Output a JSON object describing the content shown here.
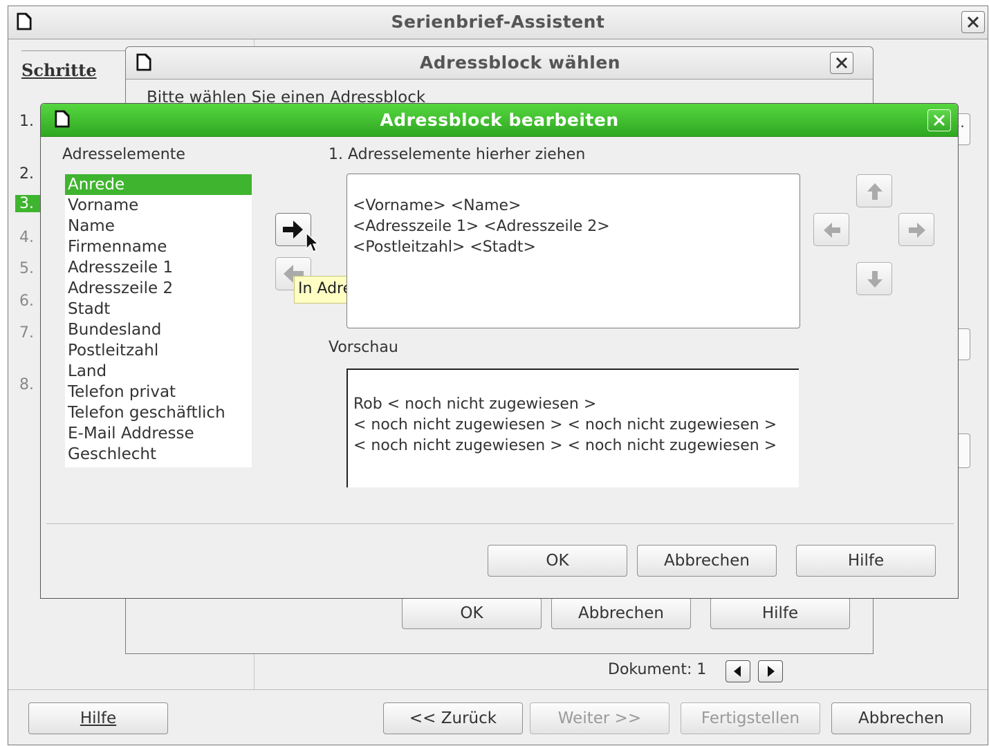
{
  "main_window": {
    "title": "Serienbrief-Assistent",
    "steps_heading": "Schritte",
    "steps": [
      "1.",
      "2.",
      "3.",
      "4.",
      "5.",
      "6.",
      "7.",
      "8."
    ],
    "doc_label": "Dokument: 1",
    "buttons": {
      "help": "Hilfe",
      "back": "<< Zurück",
      "next": "Weiter >>",
      "finish": "Fertigstellen",
      "cancel": "Abbrechen"
    }
  },
  "choose_window": {
    "title": "Adressblock wählen",
    "instruction": "Bitte wählen Sie einen Adressblock",
    "buttons": {
      "ok": "OK",
      "cancel": "Abbrechen",
      "help": "Hilfe"
    }
  },
  "edit_dialog": {
    "title": "Adressblock bearbeiten",
    "elements_label": "Adresselemente",
    "elements": [
      "Anrede",
      "Vorname",
      "Name",
      "Firmenname",
      "Adresszeile 1",
      "Adresszeile 2",
      "Stadt",
      "Bundesland",
      "Postleitzahl",
      "Land",
      "Telefon privat",
      "Telefon geschäftlich",
      "E-Mail Addresse",
      "Geschlecht"
    ],
    "selected_element": "Anrede",
    "drag_label": "1. Adresselemente hierher ziehen",
    "address_lines": [
      "<Vorname> <Name>",
      "<Adresszeile 1> <Adresszeile 2>",
      "<Postleitzahl> <Stadt>"
    ],
    "tooltip": "In Adresse übernehmen",
    "preview_label": "Vorschau",
    "preview_lines": [
      "Rob < noch nicht zugewiesen >",
      "< noch nicht zugewiesen > < noch nicht zugewiesen >",
      "< noch nicht zugewiesen > < noch nicht zugewiesen >"
    ],
    "buttons": {
      "ok": "OK",
      "cancel": "Abbrechen",
      "help": "Hilfe"
    },
    "accent_color": "#3fb42f"
  }
}
